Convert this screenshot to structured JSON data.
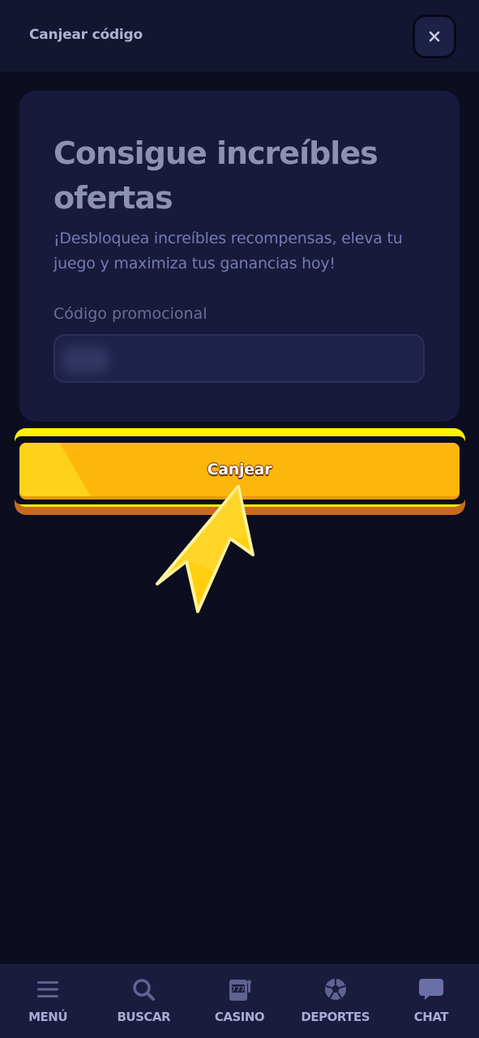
{
  "header": {
    "title": "Canjear código",
    "close_icon": "close-icon"
  },
  "card": {
    "title": "Consigue increíbles ofertas",
    "subtitle": "¡Desbloquea increíbles recompensas, eleva tu juego y maximiza tus ganancias hoy!",
    "field_label": "Código promocional",
    "field_value": ""
  },
  "redeem_button": {
    "label": "Canjear"
  },
  "bottom_nav": {
    "items": [
      {
        "label": "MENÚ",
        "icon": "menu-icon"
      },
      {
        "label": "BUSCAR",
        "icon": "search-icon"
      },
      {
        "label": "CASINO",
        "icon": "slot-machine-icon"
      },
      {
        "label": "DEPORTES",
        "icon": "soccer-ball-icon"
      },
      {
        "label": "CHAT",
        "icon": "chat-bubble-icon"
      }
    ]
  },
  "colors": {
    "background": "#0c0e20",
    "header": "#141631",
    "card": "#171a3a",
    "accent_yellow": "#fdb70a",
    "nav_background": "#1a1c3e",
    "nav_text": "#a7abd2"
  }
}
